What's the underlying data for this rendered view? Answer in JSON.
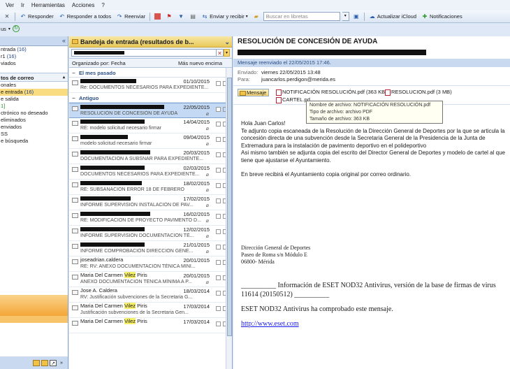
{
  "menubar": {
    "items": [
      "Ver",
      "Ir",
      "Herramientas",
      "Acciones",
      "?"
    ]
  },
  "toolbar": {
    "reply": "Responder",
    "reply_all": "Responder a todos",
    "forward": "Reenviar",
    "send_receive": "Enviar y recibir",
    "search_placeholder": "Buscar en libretas",
    "icloud": "Actualizar iCloud",
    "notifications": "Notificaciones"
  },
  "subbar": {
    "label": "us"
  },
  "folders": {
    "items": [
      {
        "label": "ntrada",
        "count": "(16)"
      },
      {
        "label": "r1",
        "count": "(16)"
      },
      {
        "label": "viados",
        "count": ""
      }
    ],
    "section_title": "tos de correo",
    "mail_items": [
      {
        "label": "onales",
        "count": ""
      },
      {
        "label": "e entrada",
        "count": "(16)",
        "selected": true
      },
      {
        "label": "e salida",
        "count": ""
      },
      {
        "label": "1]",
        "count": "",
        "green": true
      },
      {
        "label": "ctrónico no deseado",
        "count": ""
      },
      {
        "label": "eliminados",
        "count": ""
      },
      {
        "label": "enviados",
        "count": ""
      },
      {
        "label": "SS",
        "count": ""
      },
      {
        "label": "e búsqueda",
        "count": ""
      }
    ]
  },
  "inbox": {
    "title": "Bandeja de entrada (resultados de b...",
    "sort_by": "Organizado por: Fecha",
    "sort_order": "Más nuevo encima",
    "groups": [
      {
        "label": "El mes pasado",
        "messages": [
          {
            "from": "",
            "from_redacted": true,
            "redact_w": 80,
            "date": "01/10/2015",
            "subject": "Re: DOCUMENTOS NECESARIOS PARA EXPEDIENTE...",
            "attach": false
          }
        ]
      },
      {
        "label": "Antiguo",
        "messages": [
          {
            "from": "",
            "from_redacted": true,
            "redact_w": 120,
            "date": "22/05/2015",
            "subject": "RESOLUCIÓN DE CONCESIÓN DE AYUDA",
            "attach": true,
            "selected": true
          },
          {
            "from": "",
            "from_redacted": true,
            "redact_w": 92,
            "date": "14/04/2015",
            "subject": "RE: modelo solicitud necesario firmar",
            "attach": true
          },
          {
            "from": "",
            "from_redacted": true,
            "redact_w": 68,
            "date": "09/04/2015",
            "subject": "modelo solicitud necesario firmar",
            "attach": true
          },
          {
            "from": "",
            "from_redacted": true,
            "redact_w": 100,
            "date": "20/03/2015",
            "subject": "DOCUMENTACIÓN A SUBSNAR PARA EXPEDIENTE...",
            "attach": false
          },
          {
            "from": "",
            "from_redacted": true,
            "redact_w": 92,
            "date": "02/03/2015",
            "subject": "DOCUMENTOS NECESARIOS PARA EXPEDIENTE...",
            "attach": true
          },
          {
            "from": "",
            "from_redacted": true,
            "redact_w": 88,
            "date": "18/02/2015",
            "subject": "RE: SUBSANACION ERROR 18 DE FEBRERO",
            "attach": true
          },
          {
            "from": "",
            "from_redacted": true,
            "redact_w": 72,
            "date": "17/02/2015",
            "subject": "INFORME SUPERVISIÓN INSTALACIÓN DE PAV...",
            "attach": true
          },
          {
            "from": "",
            "from_redacted": true,
            "redact_w": 100,
            "date": "16/02/2015",
            "subject": "RE: MODIFICACION DE PROYECTO PAVIMENTO D...",
            "attach": true
          },
          {
            "from": "",
            "from_redacted": true,
            "redact_w": 92,
            "date": "12/02/2015",
            "subject": "INFORME SUPERVISIÓN DOCUMENTACIÓN TÉ...",
            "attach": true
          },
          {
            "from": "",
            "from_redacted": true,
            "redact_w": 92,
            "date": "21/01/2015",
            "subject": "INFORME COMPROBACIÓN DIRECCIÓN GENE...",
            "attach": true
          },
          {
            "from": "joseadrian.caldera",
            "from_redacted": false,
            "date": "20/01/2015",
            "subject": "RE: RV: ANEXO DOCUMENTACIÓN TÉNICA MINI...",
            "attach": false
          },
          {
            "from": "Maria Del Carmen Vilez Piris",
            "from_redacted": false,
            "date": "20/01/2015",
            "subject": "ANEXO DOCUMENTACIÓN TÉNICA MÍNIMA A P...",
            "attach": true
          },
          {
            "from": "Jose A. Caldera",
            "from_redacted": false,
            "date": "18/03/2014",
            "subject": "RV: Justificación subvenciones de la Secretaria G...",
            "attach": false
          },
          {
            "from": "Maria Del Carmen Vilez Piris",
            "from_redacted": false,
            "date": "17/03/2014",
            "subject": "Justificación subvenciones de la Secretaria Gen...",
            "attach": false
          },
          {
            "from": "Maria Del Carmen Vilez Piris",
            "from_redacted": false,
            "date": "17/03/2014",
            "subject": "",
            "attach": false
          }
        ]
      }
    ]
  },
  "reading": {
    "subject": "RESOLUCIÓN DE CONCESIÓN DE AYUDA",
    "info_bar": "Mensaje reenviado el 22/05/2015 17:46.",
    "sent_label": "Enviado:",
    "sent_value": "viernes 22/05/2015 13:48",
    "to_label": "Para:",
    "to_value": "juancarlos.perdigon@merida.es",
    "message_button": "Mensaje",
    "attachments": [
      "NOTIFICACIÓN RESOLUCIÓN.pdf (363 KB)",
      "RESOLUCION.pdf (3 MB)",
      "CARTEL.pd"
    ],
    "tooltip": {
      "line1": "Nombre de archivo:  NOTIFICACIÓN RESOLUCIÓN.pdf",
      "line2": "Tipo de archivo: archivo PDF",
      "line3": "Tamaño de archivo: 363 KB"
    },
    "greeting": "Hola Juan Carlos!",
    "body1": "Te adjunto copia escaneada de la Resolución de la Dirección General de Deportes por la que se articula la concesión directa de una subvención desde la Secretaria General de la Presidencia de la Junta de Extremadura para la instalación de pavimento deportivo en el polideportivo",
    "body2": "Asi mismo también se adjunta copia del escrito del Director General de Deportes y modelo de cartel al que tiene que ajustarse el Ayuntamiento.",
    "body3": "En breve recibirá el Ayuntamiento copia original por correo ordinario.",
    "sig1": "Dirección General de Deportes",
    "sig2": "Paseo de Roma s/n  Módulo E",
    "sig3": "06800- Mérida",
    "eset1": "__________ Información de ESET NOD32 Antivirus, versión de la base de firmas de virus 11614 (20150512) __________",
    "eset2": "ESET NOD32 Antivirus ha comprobado este mensaje.",
    "eset_link": "http://www.eset.com"
  }
}
